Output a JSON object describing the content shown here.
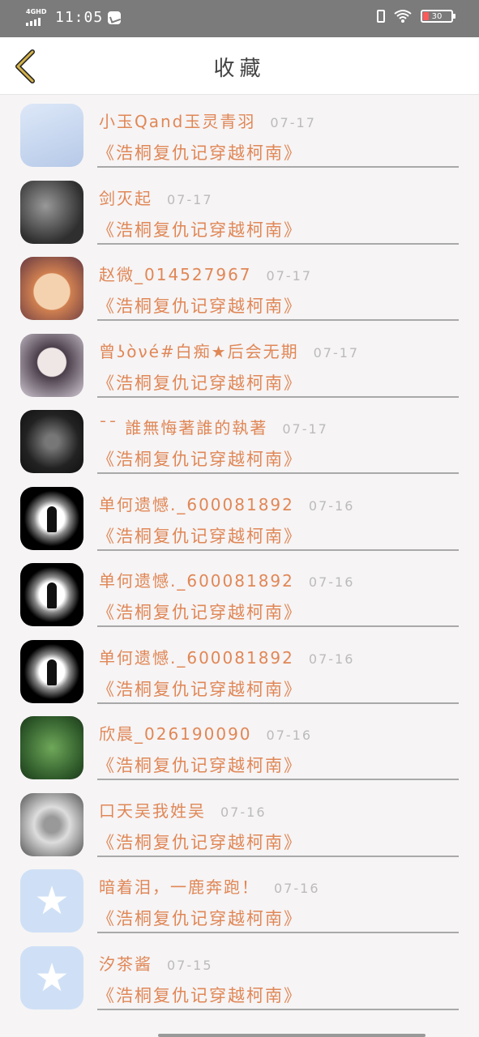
{
  "status": {
    "network": "4GHD",
    "time": "11:05",
    "battery": "30"
  },
  "header": {
    "title": "收藏"
  },
  "items": [
    {
      "name": "小玉Qand玉灵青羽",
      "date": "07-17",
      "title": "《浩桐复仇记穿越柯南》",
      "avatar": "anime-avatar"
    },
    {
      "name": "剑灭起",
      "date": "07-17",
      "title": "《浩桐复仇记穿越柯南》",
      "avatar": "dark-avatar"
    },
    {
      "name": "赵微_014527967",
      "date": "07-17",
      "title": "《浩桐复仇记穿越柯南》",
      "avatar": "cat-avatar"
    },
    {
      "name": "曾ʖòνé#白痴★后会无期",
      "date": "07-17",
      "title": "《浩桐复仇记穿越柯南》",
      "avatar": "person-avatar"
    },
    {
      "name": "ˉˉ 誰無悔著誰的執著",
      "date": "07-17",
      "title": "《浩桐复仇记穿越柯南》",
      "avatar": "flower-avatar"
    },
    {
      "name": "单何遗憾._600081892",
      "date": "07-16",
      "title": "《浩桐复仇记穿越柯南》",
      "avatar": "moon-avatar"
    },
    {
      "name": "单何遗憾._600081892",
      "date": "07-16",
      "title": "《浩桐复仇记穿越柯南》",
      "avatar": "moon-avatar"
    },
    {
      "name": "单何遗憾._600081892",
      "date": "07-16",
      "title": "《浩桐复仇记穿越柯南》",
      "avatar": "moon-avatar"
    },
    {
      "name": "欣晨_026190090",
      "date": "07-16",
      "title": "《浩桐复仇记穿越柯南》",
      "avatar": "plant-avatar"
    },
    {
      "name": "口天吴我姓吴",
      "date": "07-16",
      "title": "《浩桐复仇记穿越柯南》",
      "avatar": "figure-avatar"
    },
    {
      "name": "暗着泪，一鹿奔跑！",
      "date": "07-16",
      "title": "《浩桐复仇记穿越柯南》",
      "avatar": "qq-avatar"
    },
    {
      "name": "汐茶酱",
      "date": "07-15",
      "title": "《浩桐复仇记穿越柯南》",
      "avatar": "qq-avatar"
    }
  ]
}
